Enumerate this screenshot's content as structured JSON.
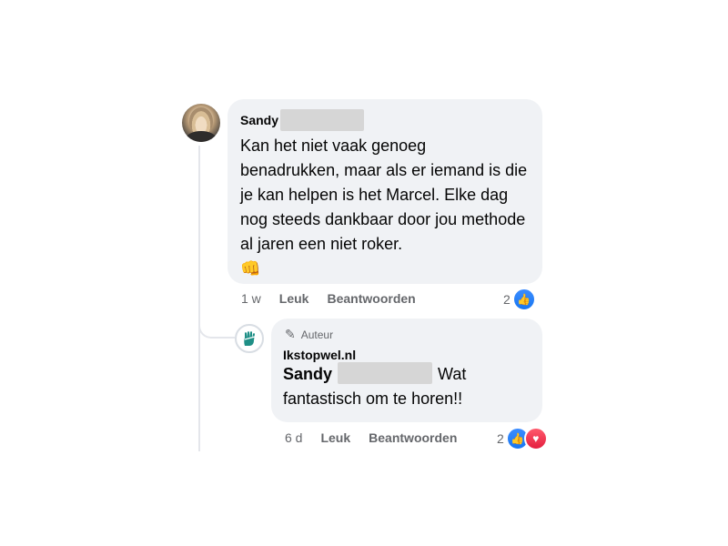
{
  "comment": {
    "author": "Sandy",
    "text": "Kan het niet vaak genoeg benadrukken, maar als er iemand is die je kan helpen is het Marcel. Elke dag nog steeds dankbaar door jou methode al jaren een niet roker.",
    "emoji": "👊",
    "time": "1 w",
    "like_label": "Leuk",
    "reply_label": "Beantwoorden",
    "reaction_count": "2",
    "like_icon": "👍"
  },
  "reply": {
    "badge": "Auteur",
    "badge_icon": "✎",
    "page_name": "Ikstopwel.nl",
    "mention": "Sandy",
    "text_part1": "Wat",
    "text_part2": "fantastisch om te horen!!",
    "time": "6 d",
    "like_label": "Leuk",
    "reply_label": "Beantwoorden",
    "reaction_count": "2",
    "like_icon": "👍",
    "love_icon": "♥"
  },
  "colors": {
    "bubble": "#f0f2f5",
    "meta_text": "#65676b",
    "like_blue": "#1877f2",
    "love_red": "#e41e3f",
    "thread_line": "#e4e6eb",
    "logo_teal": "#1f8f86"
  }
}
